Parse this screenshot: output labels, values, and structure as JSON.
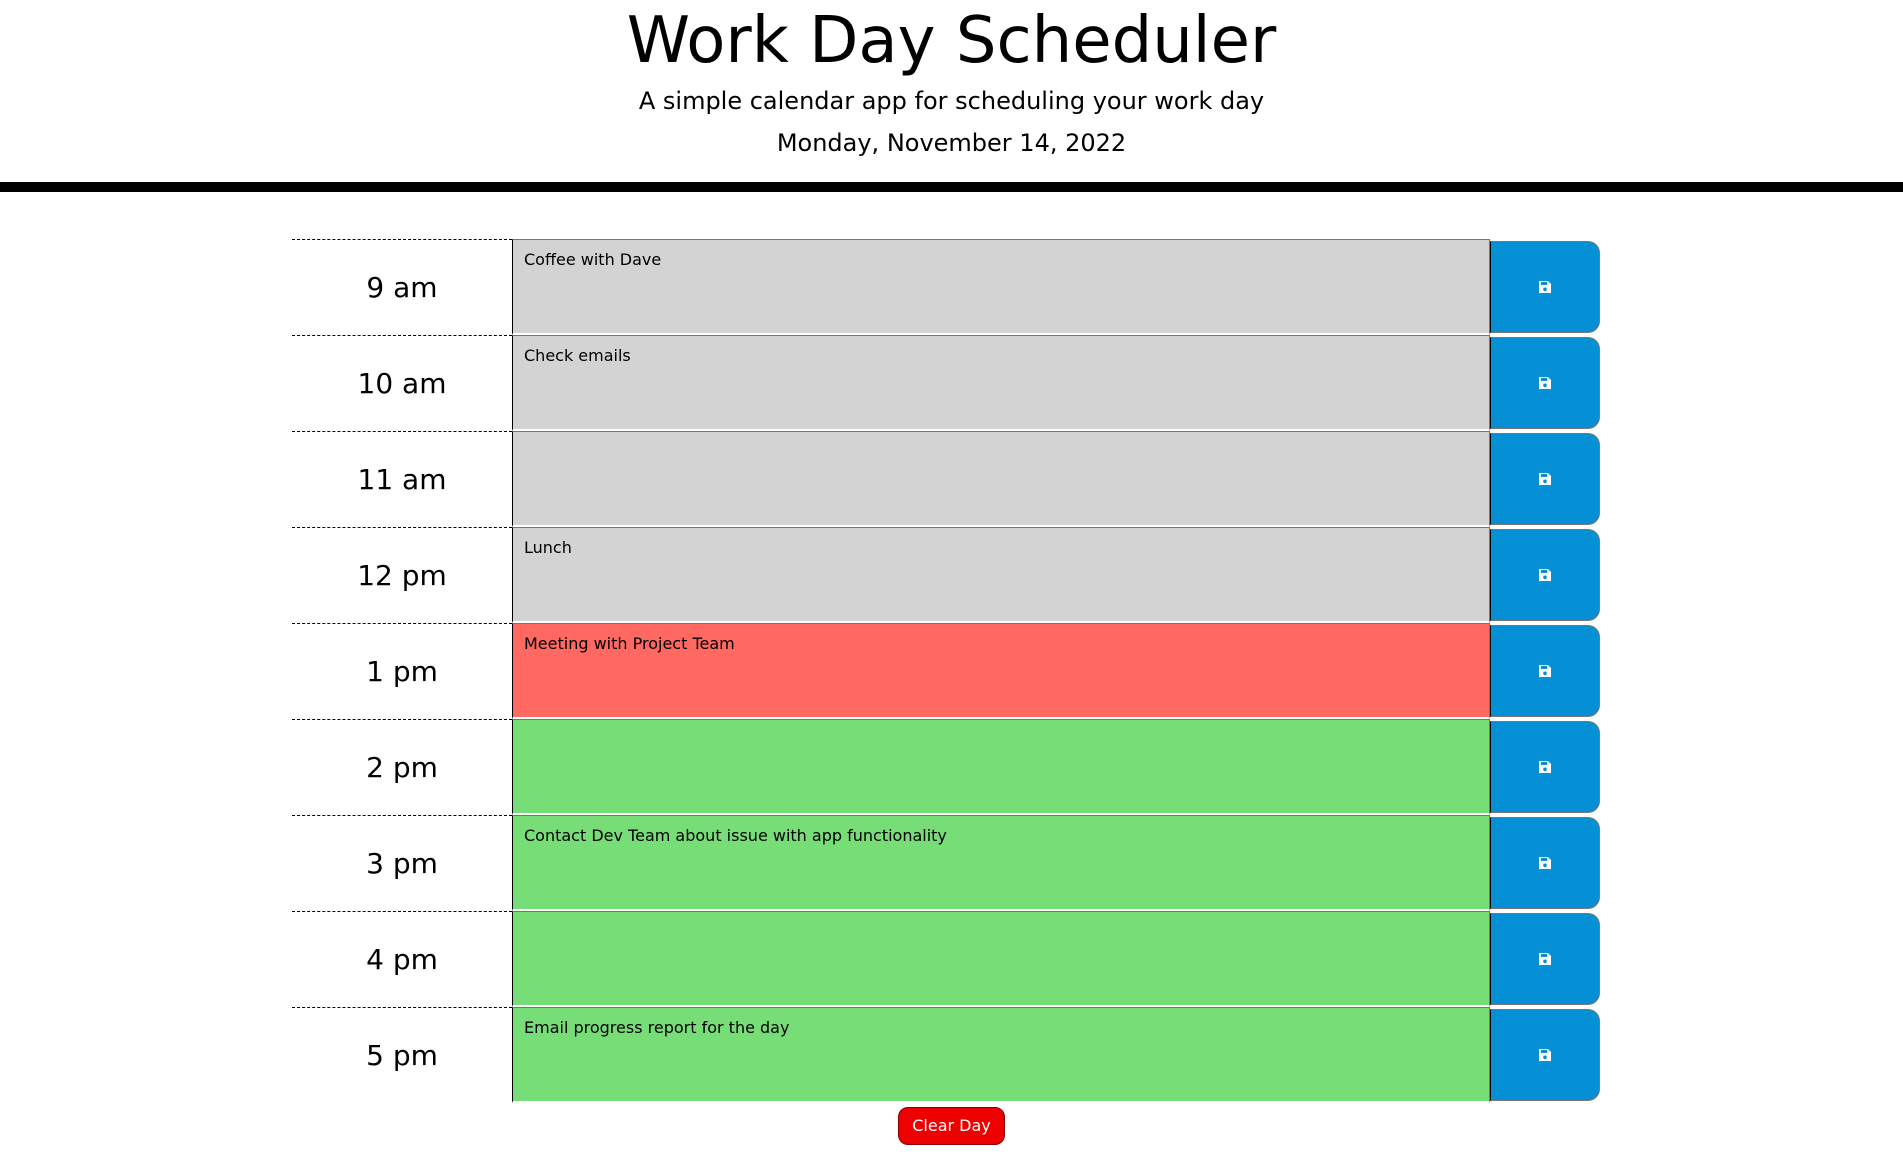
{
  "header": {
    "title": "Work Day Scheduler",
    "subtitle": "A simple calendar app for scheduling your work day",
    "date": "Monday, November 14, 2022"
  },
  "colors": {
    "past": "#d3d3d3",
    "present": "#ff6961",
    "future": "#77dd77",
    "save_button": "#0590d6",
    "clear_button": "#ee0000"
  },
  "time_blocks": [
    {
      "hour": "9 am",
      "text": "Coffee with Dave",
      "state": "past"
    },
    {
      "hour": "10 am",
      "text": "Check emails",
      "state": "past"
    },
    {
      "hour": "11 am",
      "text": "",
      "state": "past"
    },
    {
      "hour": "12 pm",
      "text": "Lunch",
      "state": "past"
    },
    {
      "hour": "1 pm",
      "text": "Meeting with Project Team",
      "state": "present"
    },
    {
      "hour": "2 pm",
      "text": "",
      "state": "future"
    },
    {
      "hour": "3 pm",
      "text": "Contact Dev Team about issue with app functionality",
      "state": "future"
    },
    {
      "hour": "4 pm",
      "text": "",
      "state": "future"
    },
    {
      "hour": "5 pm",
      "text": "Email progress report for the day",
      "state": "future"
    }
  ],
  "save_icon": "floppy-disk-icon",
  "clear_button": {
    "label": "Clear Day"
  }
}
